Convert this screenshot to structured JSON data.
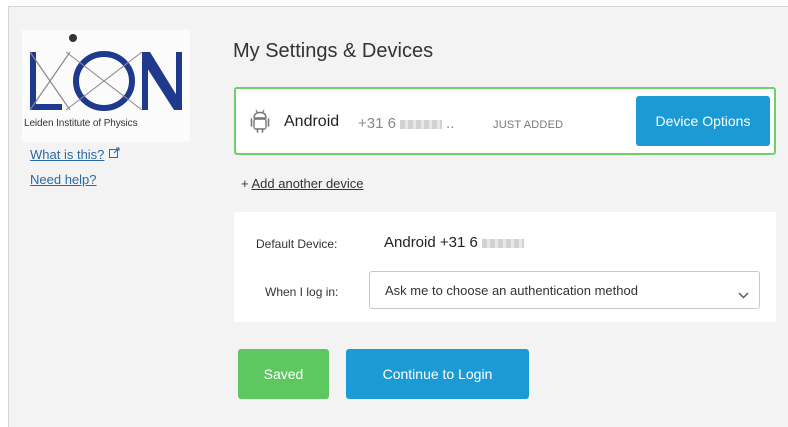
{
  "sidebar": {
    "logo_text": "LION",
    "logo_caption": "Leiden Institute of Physics",
    "what_is_this": "What is this?",
    "need_help": "Need help?"
  },
  "main": {
    "title": "My Settings & Devices",
    "device": {
      "icon": "android-icon",
      "name": "Android",
      "number_prefix": "+31 6",
      "number_suffix": "..",
      "status": "JUST ADDED",
      "options_label": "Device Options"
    },
    "add_device_prefix": "+",
    "add_device_label": "Add another device",
    "settings": {
      "default_device_label": "Default Device:",
      "default_device_value": "Android +31 6",
      "when_login_label": "When I log in:",
      "login_method": "Ask me to choose an authentication method"
    },
    "buttons": {
      "saved": "Saved",
      "continue": "Continue to Login"
    }
  },
  "colors": {
    "primary": "#1b9ad6",
    "success": "#5dc760",
    "card_border": "#6fcf6b",
    "link": "#2a6aa8"
  }
}
